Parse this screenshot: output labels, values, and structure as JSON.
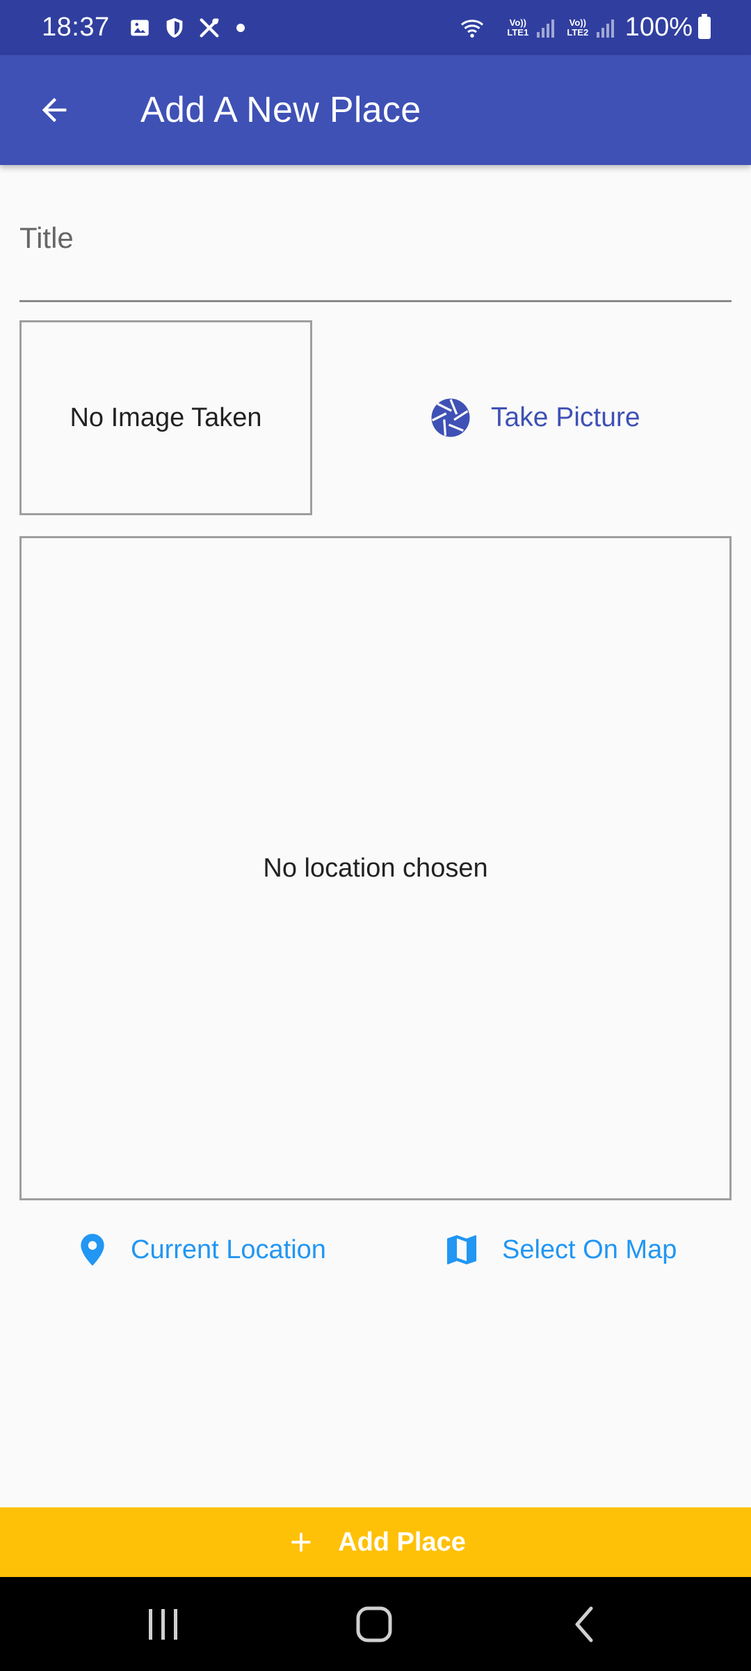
{
  "status_bar": {
    "time": "18:37",
    "icons": [
      "gallery-icon",
      "shield-icon",
      "tools-icon",
      "dot-icon",
      "wifi-icon",
      "signal-lte1-icon",
      "signal-lte2-icon",
      "battery-icon"
    ],
    "volte1": "Vo)) LTE1",
    "volte2": "Vo)) LTE2",
    "battery": "100%"
  },
  "app_bar": {
    "title": "Add A New Place",
    "back_icon": "arrow-back-icon"
  },
  "form": {
    "title_placeholder": "Title",
    "image_preview_text": "No Image Taken",
    "take_picture_label": "Take Picture",
    "take_picture_icon": "camera-shutter-icon",
    "location_preview_text": "No location chosen",
    "current_location_label": "Current Location",
    "current_location_icon": "location-pin-icon",
    "select_on_map_label": "Select On Map",
    "select_on_map_icon": "map-icon"
  },
  "footer": {
    "add_place_label": "Add Place",
    "add_place_icon": "plus-icon"
  },
  "nav_bar": {
    "buttons": [
      "recents-icon",
      "home-icon",
      "back-icon"
    ]
  },
  "colors": {
    "status_bar": "#303f9f",
    "primary": "#3f51b5",
    "accent_blue": "#2196f3",
    "amber": "#ffc107",
    "background": "#fafafa"
  }
}
